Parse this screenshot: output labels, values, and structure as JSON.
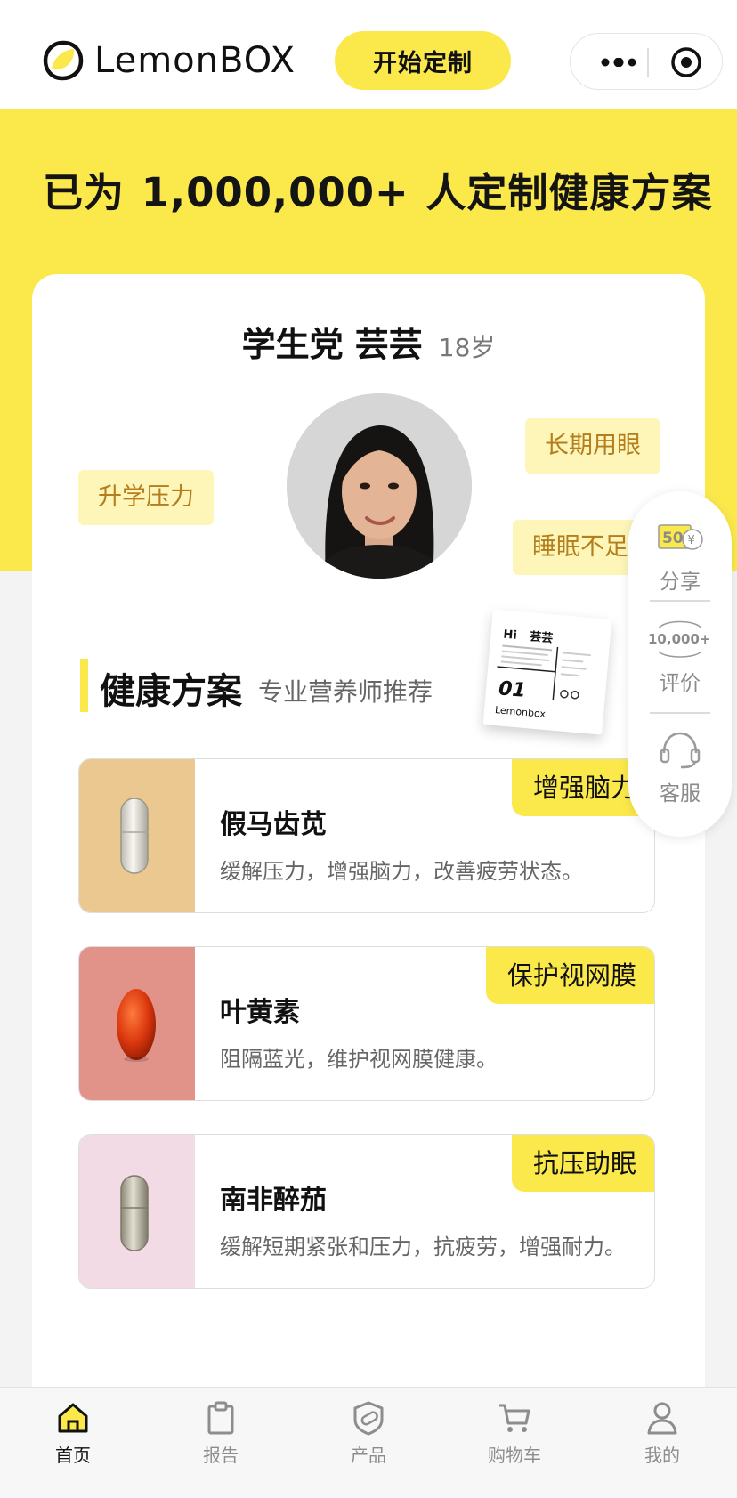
{
  "header": {
    "brand": "LemonBOX",
    "start_button": "开始定制"
  },
  "hero": {
    "headline_prefix": "已为",
    "headline_number": "1,000,000+",
    "headline_suffix": "人定制健康方案"
  },
  "persona": {
    "name": "学生党 芸芸",
    "age": "18岁",
    "tags": [
      "升学压力",
      "长期用眼",
      "睡眠不足"
    ]
  },
  "report_card": {
    "greeting": "Hi",
    "name": "芸芸",
    "number": "01",
    "brand": "Lemonbox"
  },
  "plan": {
    "title": "健康方案",
    "subtitle": "专业营养师推荐",
    "products": [
      {
        "name": "假马齿苋",
        "desc": "缓解压力，增强脑力，改善疲劳状态。",
        "badge": "增强脑力",
        "color": "#ecc891"
      },
      {
        "name": "叶黄素",
        "desc": "阻隔蓝光，维护视网膜健康。",
        "badge": "保护视网膜",
        "color": "#e1938a"
      },
      {
        "name": "南非醉茄",
        "desc": "缓解短期紧张和压力，抗疲劳，增强耐力。",
        "badge": "抗压助眠",
        "color": "#f2dbe4"
      }
    ]
  },
  "side_bar": {
    "share_amount": "50",
    "share_label": "分享",
    "review_count": "10,000+",
    "review_label": "评价",
    "service_label": "客服"
  },
  "tabbar": {
    "items": [
      {
        "label": "首页",
        "icon": "home-icon",
        "active": true
      },
      {
        "label": "报告",
        "icon": "clipboard-icon",
        "active": false
      },
      {
        "label": "产品",
        "icon": "product-icon",
        "active": false
      },
      {
        "label": "购物车",
        "icon": "cart-icon",
        "active": false
      },
      {
        "label": "我的",
        "icon": "user-icon",
        "active": false
      }
    ]
  },
  "colors": {
    "brand_yellow": "#fbe94b",
    "tag_bg": "#fdf6b8",
    "tag_text": "#b47d1d"
  }
}
